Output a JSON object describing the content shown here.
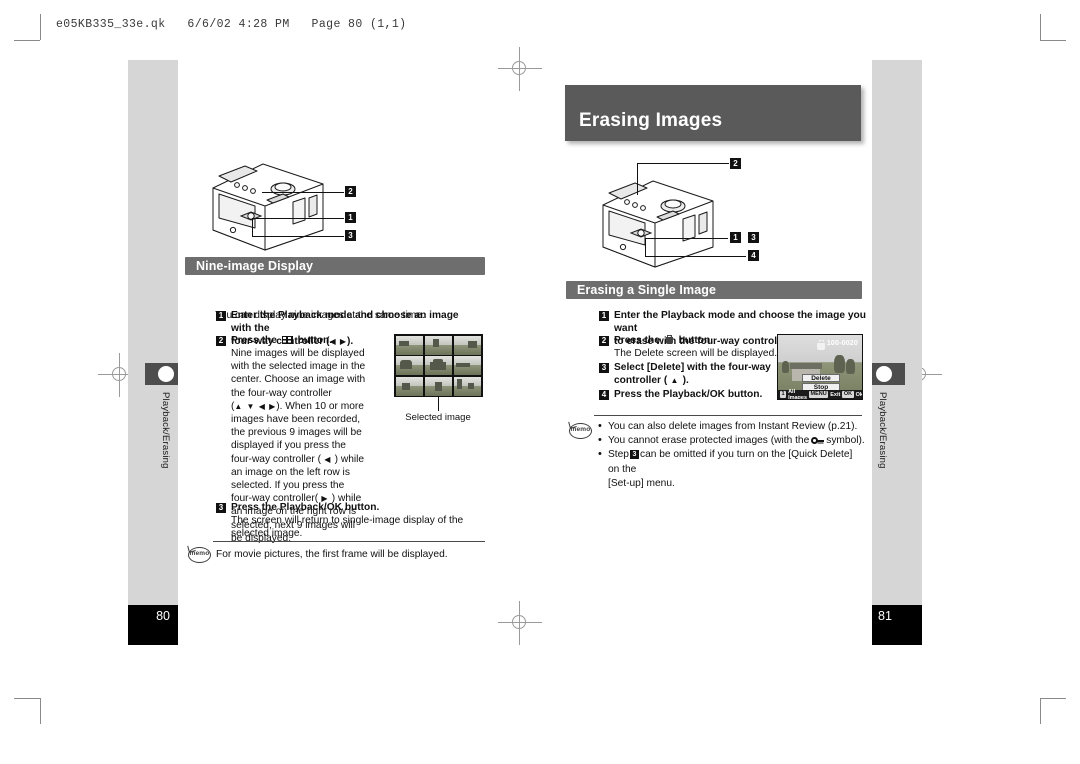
{
  "prepress": {
    "slug": "e05KB335_33e.qk   6/6/02 4:28 PM   Page 80 (1,1)"
  },
  "left_page": {
    "page_number": "80",
    "side_tab_label": "Playback/Erasing",
    "section": {
      "heading": "Nine-image Display",
      "intro": "You can display nine images at the same time."
    },
    "steps": [
      {
        "num": "1",
        "title_line1": "Enter the Playback mode and choose an image with the",
        "title_line2": "four-way controller (",
        "title_line2_end": ")."
      },
      {
        "num": "2",
        "title_pre": "Press the",
        "title_post": "button.",
        "body": "Nine images will be displayed with the selected image in the center. Choose an image with the four-way controller (",
        "body_mid": "). When 10 or more images have been recorded, the previous 9 images will be displayed if you press the four-way controller (",
        "body_mid2": ") while an image on the left row is selected. If you press the four-way controller(",
        "body_end": ") while an image on the right row is selected, next 9 images will be displayed."
      },
      {
        "num": "3",
        "title": "Press the Playback/OK button.",
        "body": "The screen will return to single-image display of the selected image."
      }
    ],
    "figure": {
      "caption": "Selected image"
    },
    "memo": {
      "badge": "memo",
      "text": "For movie pictures, the first frame will be displayed."
    },
    "camera_callouts": [
      "2",
      "1",
      "3"
    ]
  },
  "right_page": {
    "page_number": "81",
    "side_tab_label": "Playback/Erasing",
    "chapter_title": "Erasing Images",
    "section": {
      "heading": "Erasing a Single Image"
    },
    "steps": [
      {
        "num": "1",
        "title_line1": "Enter the Playback mode and choose the image you want",
        "title_line2": "to erase with the four-way controller (",
        "title_line2_end": ")."
      },
      {
        "num": "2",
        "title_pre": "Press the",
        "title_post": "button.",
        "body": "The Delete screen will be displayed."
      },
      {
        "num": "3",
        "title_line1": "Select [Delete] with the four-way",
        "title_line2": "controller (",
        "title_line2_end": ")."
      },
      {
        "num": "4",
        "title": "Press the Playback/OK button."
      }
    ],
    "lcd": {
      "file_number": "100-0020",
      "menu_items": [
        "Delete",
        "Stop"
      ],
      "status": [
        {
          "key": "1",
          "label": "All Images"
        },
        {
          "key": "MENU",
          "label": "Exit"
        },
        {
          "key": "OK",
          "label": "Ok"
        }
      ]
    },
    "memo": {
      "badge": "memo",
      "bullets": [
        "You can also delete images from Instant Review (p.21).",
        "You cannot erase protected images (with the",
        "symbol).",
        "can be omitted if you turn on the [Quick Delete] on the",
        "[Set-up] menu."
      ],
      "bullet3_prefix": "Step"
    },
    "camera_callouts": [
      "2",
      "1",
      "3",
      "4"
    ]
  },
  "colors": {
    "chapter_bar": "#5a5a5a",
    "section_bar": "#6e6e6e",
    "band": "#d6d6d6",
    "black": "#000000",
    "tab": "#4d4d4d"
  }
}
